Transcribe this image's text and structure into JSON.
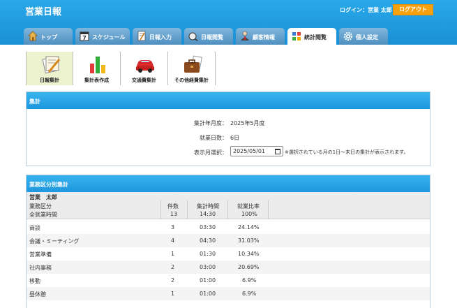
{
  "app": {
    "title": "営業日報"
  },
  "header": {
    "login_label": "ログイン：",
    "user_name": "営業 太郎",
    "logout_label": "ログアウト"
  },
  "tabs": [
    {
      "label": "トップ",
      "icon": "home-icon"
    },
    {
      "label": "スケジュール",
      "icon": "calendar-icon"
    },
    {
      "label": "日報入力",
      "icon": "report-input-icon"
    },
    {
      "label": "日報閲覧",
      "icon": "report-view-icon"
    },
    {
      "label": "顧客情報",
      "icon": "customer-icon"
    },
    {
      "label": "統計閲覧",
      "icon": "statistics-icon"
    },
    {
      "label": "個人設定",
      "icon": "gear-icon"
    }
  ],
  "subnav": [
    {
      "label": "日報集計",
      "icon": "report-summary-icon"
    },
    {
      "label": "集計表作成",
      "icon": "bar-chart-icon"
    },
    {
      "label": "交通費集計",
      "icon": "car-icon"
    },
    {
      "label": "その他経費集計",
      "icon": "briefcase-icon"
    }
  ],
  "summary": {
    "title": "集計",
    "period_label": "集計年月度",
    "period_value": "2025年5月度",
    "days_label": "就業日数",
    "days_value": "6日",
    "month_label": "表示月選択",
    "sep": "：",
    "month_value": "2025/05/01",
    "note": "※選択されている月の1日〜末日の集計が表示されます。"
  },
  "detail": {
    "title": "業務区分別集計",
    "employee": "営業　太郎",
    "headers": {
      "category": "業務区分",
      "count": "件数",
      "time": "集計時間",
      "ratio": "就業比率"
    },
    "total": {
      "label": "全就業時間",
      "count": "13",
      "time": "14:30",
      "ratio": "100%"
    },
    "rows": [
      {
        "category": "商談",
        "count": "3",
        "time": "03:30",
        "ratio": "24.14%"
      },
      {
        "category": "会議・ミーティング",
        "count": "4",
        "time": "04:30",
        "ratio": "31.03%"
      },
      {
        "category": "営業準備",
        "count": "1",
        "time": "01:30",
        "ratio": "10.34%"
      },
      {
        "category": "社内事務",
        "count": "2",
        "time": "03:00",
        "ratio": "20.69%"
      },
      {
        "category": "移動",
        "count": "2",
        "time": "01:00",
        "ratio": "6.9%"
      },
      {
        "category": "昼休憩",
        "count": "1",
        "time": "01:00",
        "ratio": "6.9%"
      }
    ]
  }
}
